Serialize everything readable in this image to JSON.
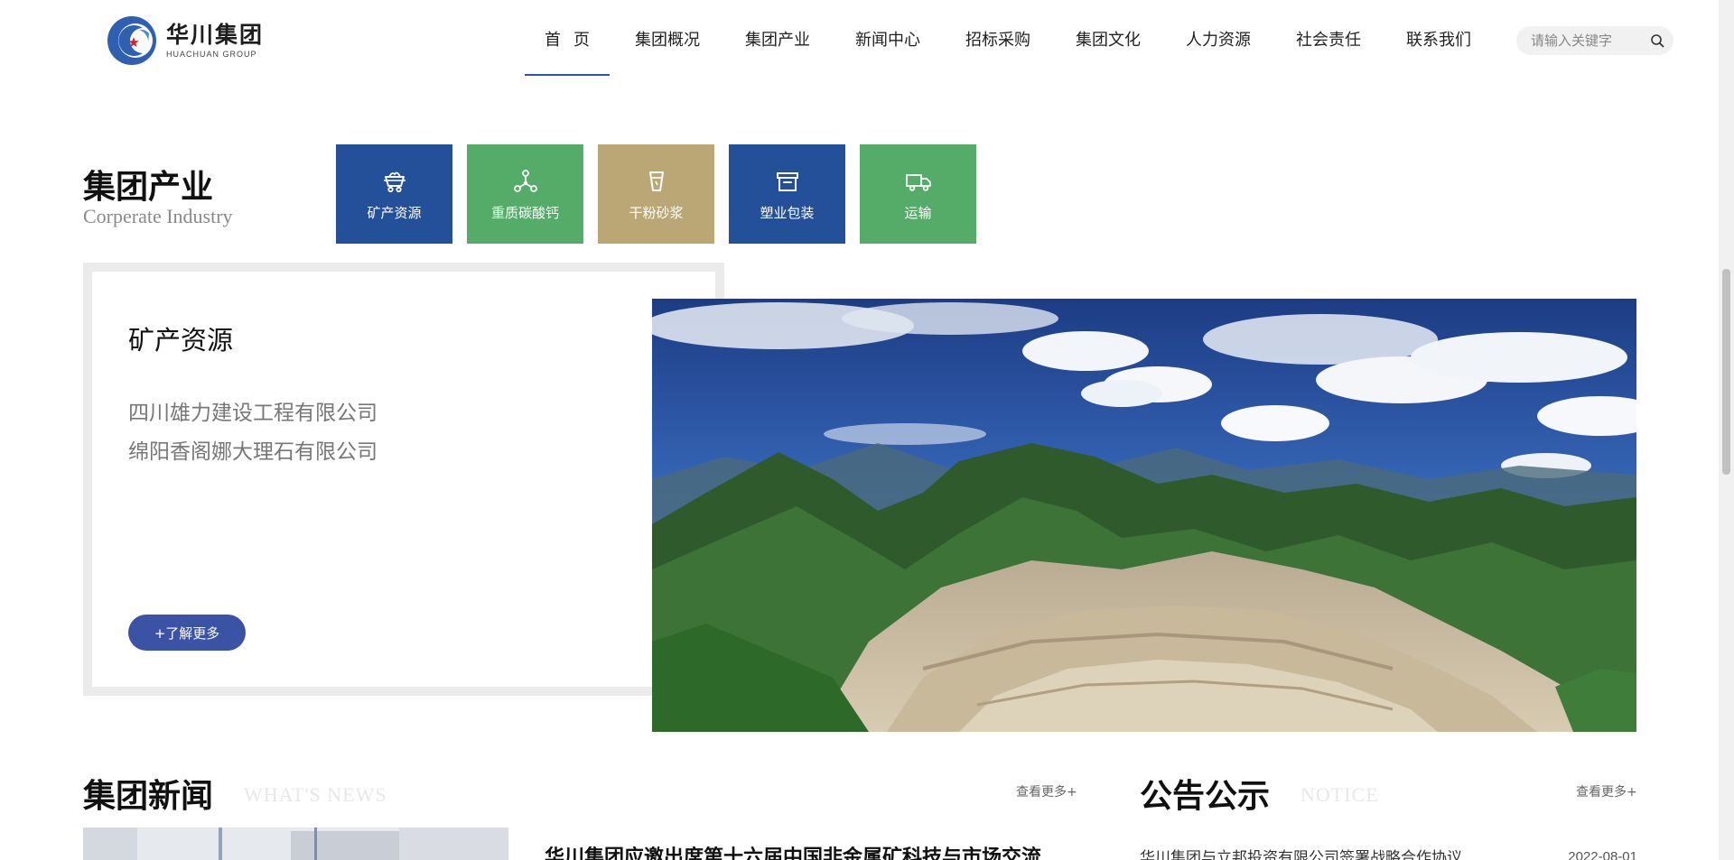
{
  "header": {
    "logo": {
      "cn": "华川集团",
      "en": "HUACHUAN GROUP"
    },
    "nav": [
      {
        "label": "首页",
        "active": true
      },
      {
        "label": "集团概况"
      },
      {
        "label": "集团产业"
      },
      {
        "label": "新闻中心"
      },
      {
        "label": "招标采购"
      },
      {
        "label": "集团文化"
      },
      {
        "label": "人力资源"
      },
      {
        "label": "社会责任"
      },
      {
        "label": "联系我们"
      }
    ],
    "search": {
      "placeholder": "请输入关键字",
      "icon": "search-icon"
    }
  },
  "industry": {
    "title": "集团产业",
    "subtitle": "Corperate Industry",
    "tiles": [
      {
        "label": "矿产资源",
        "icon": "mine-cart-icon",
        "color": "#244f99"
      },
      {
        "label": "重质碳酸钙",
        "icon": "molecule-icon",
        "color": "#55ab68"
      },
      {
        "label": "干粉砂浆",
        "icon": "cup-icon",
        "color": "#bba776"
      },
      {
        "label": "塑业包装",
        "icon": "archive-box-icon",
        "color": "#244f99"
      },
      {
        "label": "运输",
        "icon": "truck-icon",
        "color": "#55ab68"
      }
    ],
    "panel": {
      "title": "矿产资源",
      "companies": [
        "四川雄力建设工程有限公司",
        "绵阳香阁娜大理石有限公司"
      ],
      "more_label": "+了解更多"
    }
  },
  "news": {
    "title": "集团新闻",
    "ghost": "WHAT'S NEWS",
    "more_label": "查看更多+",
    "headline": "华川集团应邀出席第十六届中国非金属矿科技与市场交流"
  },
  "notice": {
    "title": "公告公示",
    "ghost": "NOTICE",
    "more_label": "查看更多+",
    "item": "华川集团与立邦投资有限公司签署战略合作协议",
    "date": "2022-08-01"
  },
  "colors": {
    "accent": "#2d55a3",
    "button": "#3a53a4",
    "tile_blue": "#244f99",
    "tile_green": "#55ab68",
    "tile_tan": "#bba776"
  }
}
